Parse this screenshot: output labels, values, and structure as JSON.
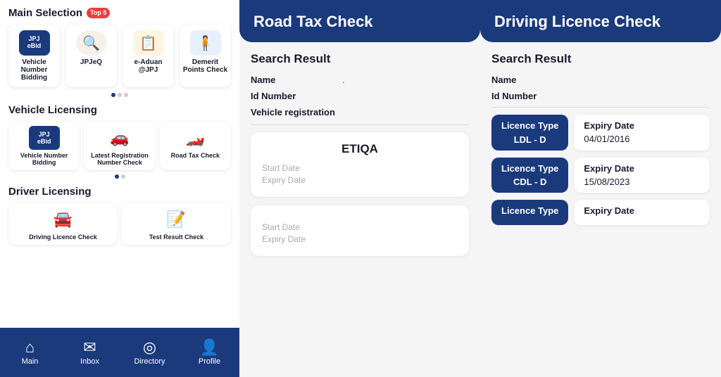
{
  "left": {
    "main_selection_title": "Main Selection",
    "badge": "Top 5",
    "cards": [
      {
        "label": "Vehicle Number Bidding",
        "icon_type": "ebid"
      },
      {
        "label": "JPJeQ",
        "icon_type": "circle"
      },
      {
        "label": "e-Aduan @JPJ",
        "icon_type": "rect"
      },
      {
        "label": "Demerit Points Check",
        "icon_type": "person"
      }
    ],
    "vehicle_licensing_title": "Vehicle Licensing",
    "vehicle_cards": [
      {
        "label": "Vehicle Number Bidding",
        "icon_type": "ebid"
      },
      {
        "label": "Latest Registration Number Check",
        "icon_type": "car"
      },
      {
        "label": "Road Tax Check",
        "icon_type": "roadtax"
      }
    ],
    "driver_licensing_title": "Driver Licensing",
    "driver_cards": [
      {
        "label": "Driving Licence Check",
        "icon_type": "driving"
      },
      {
        "label": "Test Result Check",
        "icon_type": "test"
      }
    ],
    "nav": [
      {
        "label": "Main",
        "icon": "⌂"
      },
      {
        "label": "Inbox",
        "icon": "✉"
      },
      {
        "label": "Directory",
        "icon": "◎"
      },
      {
        "label": "Profile",
        "icon": "👤"
      }
    ]
  },
  "middle": {
    "header_title": "Road Tax Check",
    "search_result_label": "Search Result",
    "fields": [
      {
        "label": "Name",
        "value": "."
      },
      {
        "label": "Id Number",
        "value": ""
      },
      {
        "label": "Vehicle registration",
        "value": ""
      }
    ],
    "insurance_cards": [
      {
        "name": "ETIQA",
        "start_date_label": "Start Date",
        "expiry_date_label": "Expiry Date"
      },
      {
        "name": "",
        "start_date_label": "Start Date",
        "expiry_date_label": "Expiry Date"
      }
    ]
  },
  "right": {
    "header_title": "Driving Licence Check",
    "search_result_label": "Search Result",
    "name_label": "Name",
    "id_label": "Id Number",
    "licence_cards": [
      {
        "type_label": "Licence Type",
        "type_value": "LDL - D",
        "expiry_label": "Expiry Date",
        "expiry_value": "04/01/2016"
      },
      {
        "type_label": "Licence Type",
        "type_value": "CDL - D",
        "expiry_label": "Expiry Date",
        "expiry_value": "15/08/2023"
      },
      {
        "type_label": "Licence Type",
        "type_value": "",
        "expiry_label": "Expiry Date",
        "expiry_value": ""
      }
    ]
  }
}
